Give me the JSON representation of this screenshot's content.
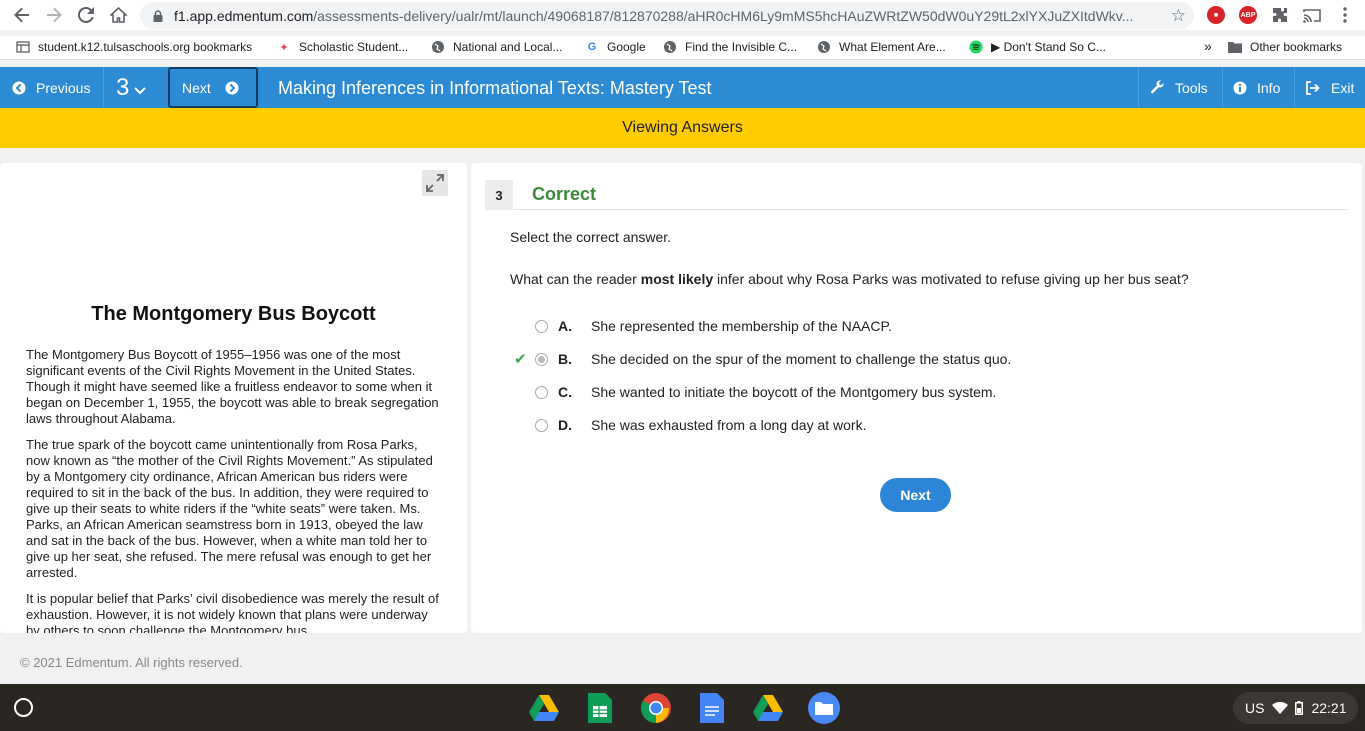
{
  "browser": {
    "url_host": "f1.app.edmentum.com",
    "url_path": "/assessments-delivery/ualr/mt/launch/49068187/812870288/aHR0cHM6Ly9mMS5hcHAuZWRtZW50dW0uY29tL2xlYXJuZXItd...",
    "url_display_suffix": "/assessments-delivery/ualr/mt/launch/49068187/812870288/aHR0cHM6Ly9mMS5hcHAuZWRtZW50dW0uY29tL2xlYXJuZXItdWkv...",
    "bookmarks": [
      {
        "label": "student.k12.tulsaschools.org bookmarks",
        "icon": "grid-icon"
      },
      {
        "label": "Scholastic Student...",
        "icon": "scholastic-icon"
      },
      {
        "label": "National and Local...",
        "icon": "globe-icon"
      },
      {
        "label": "Google",
        "icon": "google-icon"
      },
      {
        "label": "Find the Invisible C...",
        "icon": "globe-icon"
      },
      {
        "label": "What Element Are...",
        "icon": "globe-icon"
      },
      {
        "label": "▶ Don't Stand So C...",
        "icon": "spotify-icon"
      }
    ],
    "overflow": "»",
    "other_bookmarks": "Other bookmarks"
  },
  "header": {
    "previous": "Previous",
    "question_number": "3",
    "next": "Next",
    "title": "Making Inferences in Informational Texts: Mastery Test",
    "tools": "Tools",
    "info": "Info",
    "exit": "Exit"
  },
  "banner": "Viewing Answers",
  "passage": {
    "title": "The Montgomery Bus Boycott",
    "paragraphs": [
      "The Montgomery Bus Boycott of 1955–1956 was one of the most significant events of the Civil Rights Movement in the United States. Though it might have seemed like a fruitless endeavor to some when it began on December 1, 1955, the boycott was able to break segregation laws throughout Alabama.",
      "The true spark of the boycott came unintentionally from Rosa Parks, now known as “the mother of the Civil Rights Movement.” As stipulated by a Montgomery city ordinance, African American bus riders were required to sit in the back of the bus. In addition, they were required to give up their seats to white riders if the “white seats” were taken. Ms. Parks, an African American seamstress born in 1913, obeyed the law and sat in the back of the bus. However, when a white man told her to give up her seat, she refused. The mere refusal was enough to get her arrested.",
      "It is popular belief that Parks’ civil disobedience was merely the result of exhaustion. However, it is not widely known that plans were underway by others to soon challenge the Montgomery bus"
    ]
  },
  "question": {
    "number": "3",
    "status": "Correct",
    "instruction": "Select the correct answer.",
    "text_before": "What can the reader ",
    "text_bold": "most likely",
    "text_after": " infer about why Rosa Parks was motivated to refuse giving up her bus seat?",
    "options": [
      {
        "letter": "A.",
        "text": "She represented the membership of the NAACP."
      },
      {
        "letter": "B.",
        "text": "She decided on the spur of the moment to challenge the status quo."
      },
      {
        "letter": "C.",
        "text": "She wanted to initiate the boycott of the Montgomery bus system."
      },
      {
        "letter": "D.",
        "text": "She was exhausted from a long day at work."
      }
    ],
    "selected": "B.",
    "next_label": "Next"
  },
  "footer": "© 2021 Edmentum. All rights reserved.",
  "taskbar": {
    "locale": "US",
    "time": "22:21"
  },
  "colors": {
    "header_blue": "#2c8bd3",
    "banner_yellow": "#ffcc00",
    "correct_green": "#3a8a3a"
  }
}
